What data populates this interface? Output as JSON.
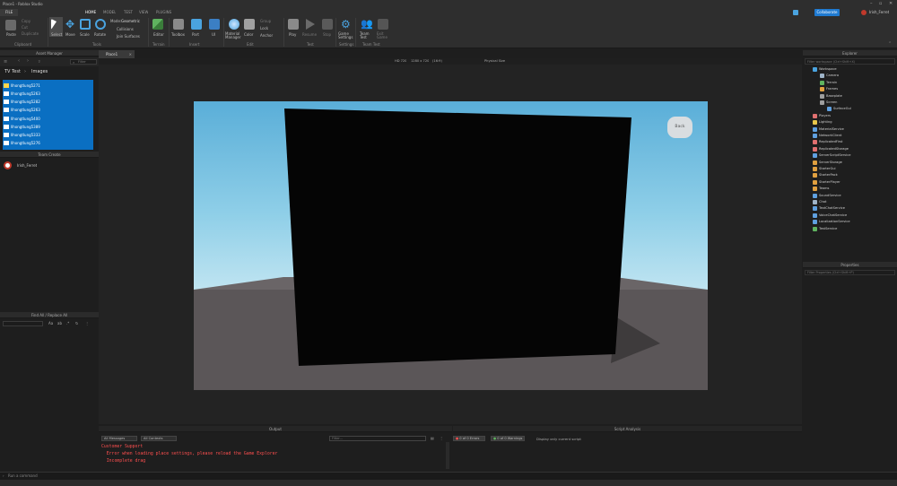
{
  "window": {
    "title": "Place1 - Roblox Studio",
    "username": "Irish_Ferret",
    "collaborate": "Collaborate"
  },
  "menu": [
    "FILE",
    "HOME",
    "MODEL",
    "TEST",
    "VIEW",
    "PLUGINS"
  ],
  "ribbon": {
    "clipboard": {
      "paste": "Paste",
      "copy": "Copy",
      "cut": "Cut",
      "duplicate": "Duplicate",
      "group": "Clipboard"
    },
    "tools": {
      "select": "Select",
      "move": "Move",
      "scale": "Scale",
      "rotate": "Rotate",
      "mode_label": "Mode:",
      "mode_value": "Geometric",
      "collisions": "Collisions",
      "join_surfaces": "Join Surfaces",
      "group": "Tools"
    },
    "terrain": {
      "editor": "Editor",
      "group": "Terrain"
    },
    "insert": {
      "toolbox": "Toolbox",
      "part": "Part",
      "ui": "UI",
      "group": "Insert"
    },
    "edit": {
      "material_manager": "Material Manager",
      "color": "Color",
      "group_btn": "Group",
      "lock": "Lock",
      "anchor": "Anchor",
      "group": "Edit"
    },
    "test": {
      "play": "Play",
      "resume": "Resume",
      "stop": "Stop",
      "group": "Test"
    },
    "settings": {
      "game_settings": "Game Settings",
      "group": "Settings"
    },
    "team_test": {
      "team_test": "Team Test",
      "exit_game": "Exit Game",
      "group": "Team Test"
    }
  },
  "asset_manager": {
    "title": "Asset Manager",
    "filter_placeholder": "Filter",
    "breadcrumb_root": "TV Test",
    "breadcrumb_leaf": "Images",
    "items": [
      "lIhongtlung5271",
      "lIhongtlung5263",
      "lIhongtlung5282",
      "lIhongtlung5263",
      "lIhongtlung5400",
      "lIhongtlung5389",
      "lIhongtlung5333",
      "lIhongtlung5276"
    ]
  },
  "team_create": {
    "title": "Team Create",
    "user": "Irish_Ferret"
  },
  "find_replace": {
    "title": "Find All / Replace All"
  },
  "document_tab": {
    "label": "Place1"
  },
  "viewport": {
    "device": "HD 720",
    "resolution": "1280 x 720",
    "scale": "(16:9)",
    "size_mode": "Physical Size",
    "back_button": "Back"
  },
  "explorer": {
    "title": "Explorer",
    "filter_placeholder": "Filter workspace (Ctrl+Shift+X)",
    "items": [
      {
        "label": "Workspace",
        "level": 0,
        "color": "#4aa3df"
      },
      {
        "label": "Camera",
        "level": 1,
        "color": "#9fb4c8"
      },
      {
        "label": "Terrain",
        "level": 1,
        "color": "#5fb35f"
      },
      {
        "label": "Frames",
        "level": 1,
        "color": "#e0a040"
      },
      {
        "label": "Baseplate",
        "level": 1,
        "color": "#9e9e9e"
      },
      {
        "label": "Screen",
        "level": 1,
        "color": "#9e9e9e"
      },
      {
        "label": "SurfaceGui",
        "level": 2,
        "color": "#5fa0e0"
      },
      {
        "label": "Players",
        "level": 0,
        "color": "#e07070"
      },
      {
        "label": "Lighting",
        "level": 0,
        "color": "#e8c64a"
      },
      {
        "label": "MaterialService",
        "level": 0,
        "color": "#5fa0e0"
      },
      {
        "label": "NetworkClient",
        "level": 0,
        "color": "#5fa0e0"
      },
      {
        "label": "ReplicatedFirst",
        "level": 0,
        "color": "#e07070"
      },
      {
        "label": "ReplicatedStorage",
        "level": 0,
        "color": "#e07070"
      },
      {
        "label": "ServerScriptService",
        "level": 0,
        "color": "#5fa0e0"
      },
      {
        "label": "ServerStorage",
        "level": 0,
        "color": "#e0a040"
      },
      {
        "label": "StarterGui",
        "level": 0,
        "color": "#e0a040"
      },
      {
        "label": "StarterPack",
        "level": 0,
        "color": "#e0a040"
      },
      {
        "label": "StarterPlayer",
        "level": 0,
        "color": "#e0a040"
      },
      {
        "label": "Teams",
        "level": 0,
        "color": "#e0a040"
      },
      {
        "label": "SoundService",
        "level": 0,
        "color": "#5fa0e0"
      },
      {
        "label": "Chat",
        "level": 0,
        "color": "#9fb4c8"
      },
      {
        "label": "TextChatService",
        "level": 0,
        "color": "#5fa0e0"
      },
      {
        "label": "VoiceChatService",
        "level": 0,
        "color": "#5fa0e0"
      },
      {
        "label": "LocalizationService",
        "level": 0,
        "color": "#5fa0e0"
      },
      {
        "label": "TestService",
        "level": 0,
        "color": "#5fb35f"
      }
    ]
  },
  "properties": {
    "title": "Properties",
    "filter_placeholder": "Filter Properties (Ctrl+Shift+P)"
  },
  "output": {
    "title": "Output",
    "messages_filter": "All Messages",
    "contexts_filter": "All Contexts",
    "filter_placeholder": "Filter...",
    "lines": [
      "Customer Support",
      "  Error when loading place settings, please reload the Game Explorer",
      "  Incomplete drag"
    ]
  },
  "script_analysis": {
    "title": "Script Analysis",
    "errors": "0 of 0 Errors",
    "warnings": "0 of 0 Warnings",
    "scope": "Display only current script"
  },
  "command_bar": {
    "placeholder": "Run a command"
  },
  "colors": {
    "selection": "#0a6fc2",
    "accent_blue": "#4aa3df",
    "error": "#ff4f4f",
    "sky": "#7fc4e3",
    "ground": "#5b5658"
  }
}
